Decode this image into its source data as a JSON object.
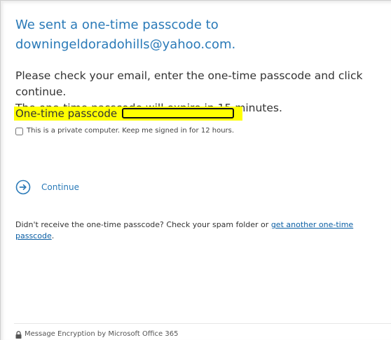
{
  "heading": {
    "line1": "We sent a one-time passcode to",
    "line2": "downingeldoradohills@yahoo.com."
  },
  "instructions": {
    "line1": "Please check your email, enter the one-time passcode and click continue.",
    "line2": "The one-time passcode will expire in 15 minutes."
  },
  "passcode": {
    "label": "One-time passcode",
    "value": "",
    "highlight_color": "#ffff00"
  },
  "remember": {
    "label": "This is a private computer. Keep me signed in for 12 hours.",
    "checked": false
  },
  "continue": {
    "label": "Continue",
    "icon": "arrow-circle-right-icon"
  },
  "resend": {
    "text": "Didn't receive the one-time passcode? Check your spam folder or ",
    "link_text": "get another one-time passcode",
    "suffix": "."
  },
  "footer": {
    "icon": "lock-icon",
    "text": "Message Encryption by Microsoft Office 365"
  },
  "colors": {
    "accent": "#2a7ab8",
    "link": "#0b5fa5",
    "text": "#333333"
  }
}
